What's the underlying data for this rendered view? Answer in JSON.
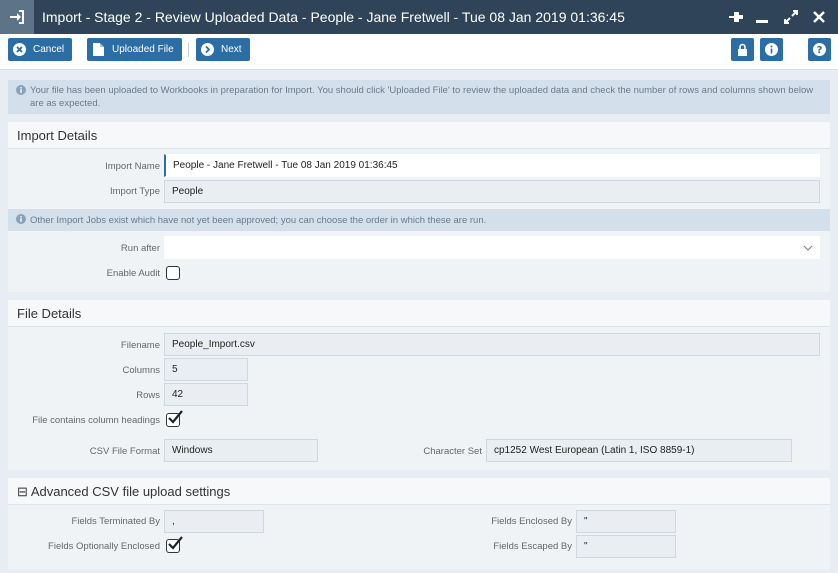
{
  "window": {
    "title": "Import - Stage 2 - Review Uploaded Data - People - Jane Fretwell - Tue 08 Jan 2019 01:36:45",
    "icons": [
      "import-icon",
      "pin-icon",
      "minimize-icon",
      "maximize-icon",
      "close-icon"
    ]
  },
  "toolbar": {
    "cancel_label": "Cancel",
    "uploaded_file_label": "Uploaded File",
    "next_label": "Next",
    "icons": [
      "lock-icon",
      "info-icon",
      "help-icon"
    ]
  },
  "info": {
    "upload_message": "Your file has been uploaded to Workbooks in preparation for Import. You should click 'Uploaded File' to review the uploaded data and check the number of rows and columns shown below are as expected.",
    "other_jobs_message": "Other Import Jobs exist which have not yet been approved; you can choose the order in which these are run."
  },
  "import_details": {
    "heading": "Import Details",
    "name_label": "Import Name",
    "name_value": "People - Jane Fretwell - Tue 08 Jan 2019 01:36:45",
    "type_label": "Import Type",
    "type_value": "People",
    "run_after_label": "Run after",
    "run_after_value": "",
    "enable_audit_label": "Enable Audit",
    "enable_audit_checked": false
  },
  "file_details": {
    "heading": "File Details",
    "filename_label": "Filename",
    "filename_value": "People_Import.csv",
    "columns_label": "Columns",
    "columns_value": "5",
    "rows_label": "Rows",
    "rows_value": "42",
    "headings_label": "File contains column headings",
    "headings_checked": true,
    "csv_format_label": "CSV File Format",
    "csv_format_value": "Windows",
    "charset_label": "Character Set",
    "charset_value": "cp1252 West European (Latin 1, ISO 8859-1)"
  },
  "advanced": {
    "heading": "Advanced CSV file upload settings",
    "collapse_symbol": "⊟",
    "terminated_label": "Fields Terminated By",
    "terminated_value": ",",
    "enclosed_label": "Fields Enclosed By",
    "enclosed_value": "\"",
    "optionally_label": "Fields Optionally Enclosed",
    "optionally_checked": true,
    "escaped_label": "Fields Escaped By",
    "escaped_value": "\""
  },
  "colors": {
    "titlebar": "#2f4458",
    "button": "#2b6ea6",
    "info_bg": "#d3e0ec",
    "panel_bg": "#f0f3f6"
  }
}
